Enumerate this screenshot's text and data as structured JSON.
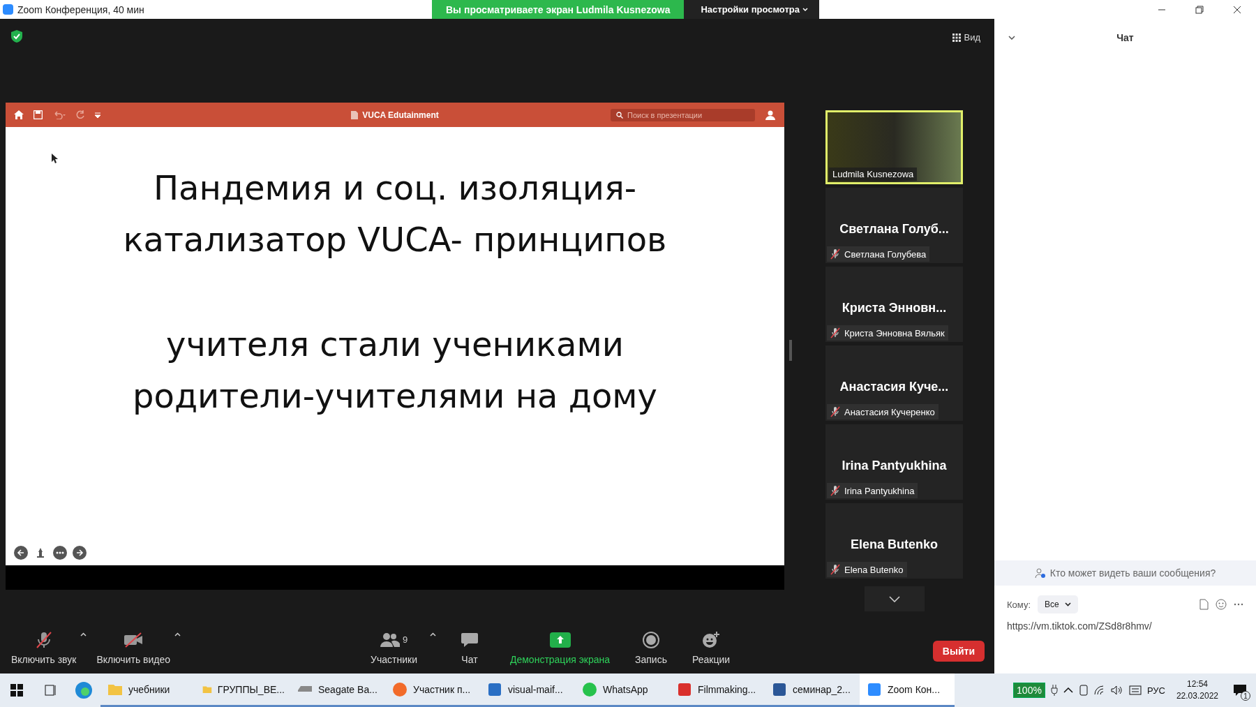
{
  "window": {
    "title": "Zoom Конференция, 40 мин"
  },
  "share_banner": {
    "viewing": "Вы просматриваете экран Ludmila Kusnezowa",
    "view_options": "Настройки просмотра"
  },
  "view_button": "Вид",
  "presentation": {
    "title": "VUCA Edutainment",
    "search": {
      "placeholder": "Поиск в презентации"
    },
    "heading": [
      "Пандемия и соц. изоляция-",
      "катализатор VUCA- принципов"
    ],
    "body": [
      "учителя стали учениками",
      "родители-учителями на дому"
    ]
  },
  "gallery": {
    "active_speaker": {
      "name": "Ludmila Kusnezowa"
    },
    "participants": [
      {
        "display": "Светлана  Голуб...",
        "name": "Светлана Голубева",
        "muted": true
      },
      {
        "display": "Криста  Энновн...",
        "name": "Криста Энновна Вяльяк",
        "muted": true
      },
      {
        "display": "Анастасия  Куче...",
        "name": "Анастасия Кучеренко",
        "muted": true
      },
      {
        "display": "Irina Pantyukhina",
        "name": "Irina Pantyukhina",
        "muted": true
      },
      {
        "display": "Elena Butenko",
        "name": "Elena Butenko",
        "muted": true
      }
    ]
  },
  "toolbar": [
    {
      "kind": "audio",
      "label": "Включить звук",
      "off": true
    },
    {
      "kind": "video",
      "label": "Включить видео",
      "off": true
    },
    {
      "kind": "participants",
      "label": "Участники",
      "count": "9"
    },
    {
      "kind": "chat",
      "label": "Чат"
    },
    {
      "kind": "share",
      "label": "Демонстрация экрана"
    },
    {
      "kind": "record",
      "label": "Запись"
    },
    {
      "kind": "reactions",
      "label": "Реакции"
    }
  ],
  "leave_button": "Выйти",
  "chat": {
    "title": "Чат",
    "privacy_note": "Кто может видеть ваши сообщения?",
    "to_label": "Кому:",
    "recipient": "Все",
    "draft": "https://vm.tiktok.com/ZSd8r8hmv/"
  },
  "taskbar": {
    "apps": [
      {
        "kind": "folder",
        "label": "учебники",
        "selected": false
      },
      {
        "kind": "folder",
        "label": "ГРУППЫ_ВЕ...",
        "selected": false
      },
      {
        "kind": "drive",
        "label": "Seagate Ba...",
        "selected": false
      },
      {
        "kind": "browser",
        "label": "Участник п...",
        "selected": false
      },
      {
        "kind": "image",
        "label": "visual-maif...",
        "selected": false
      },
      {
        "kind": "whatsapp",
        "label": "WhatsApp",
        "selected": false
      },
      {
        "kind": "pdf",
        "label": "Filmmaking...",
        "selected": false
      },
      {
        "kind": "word",
        "label": "семинар_2...",
        "selected": false
      },
      {
        "kind": "zoom",
        "label": "Zoom Кон...",
        "selected": true
      }
    ],
    "battery": "100%",
    "language": "РУС",
    "time": "12:54",
    "date": "22.03.2022",
    "notifications": "1"
  }
}
